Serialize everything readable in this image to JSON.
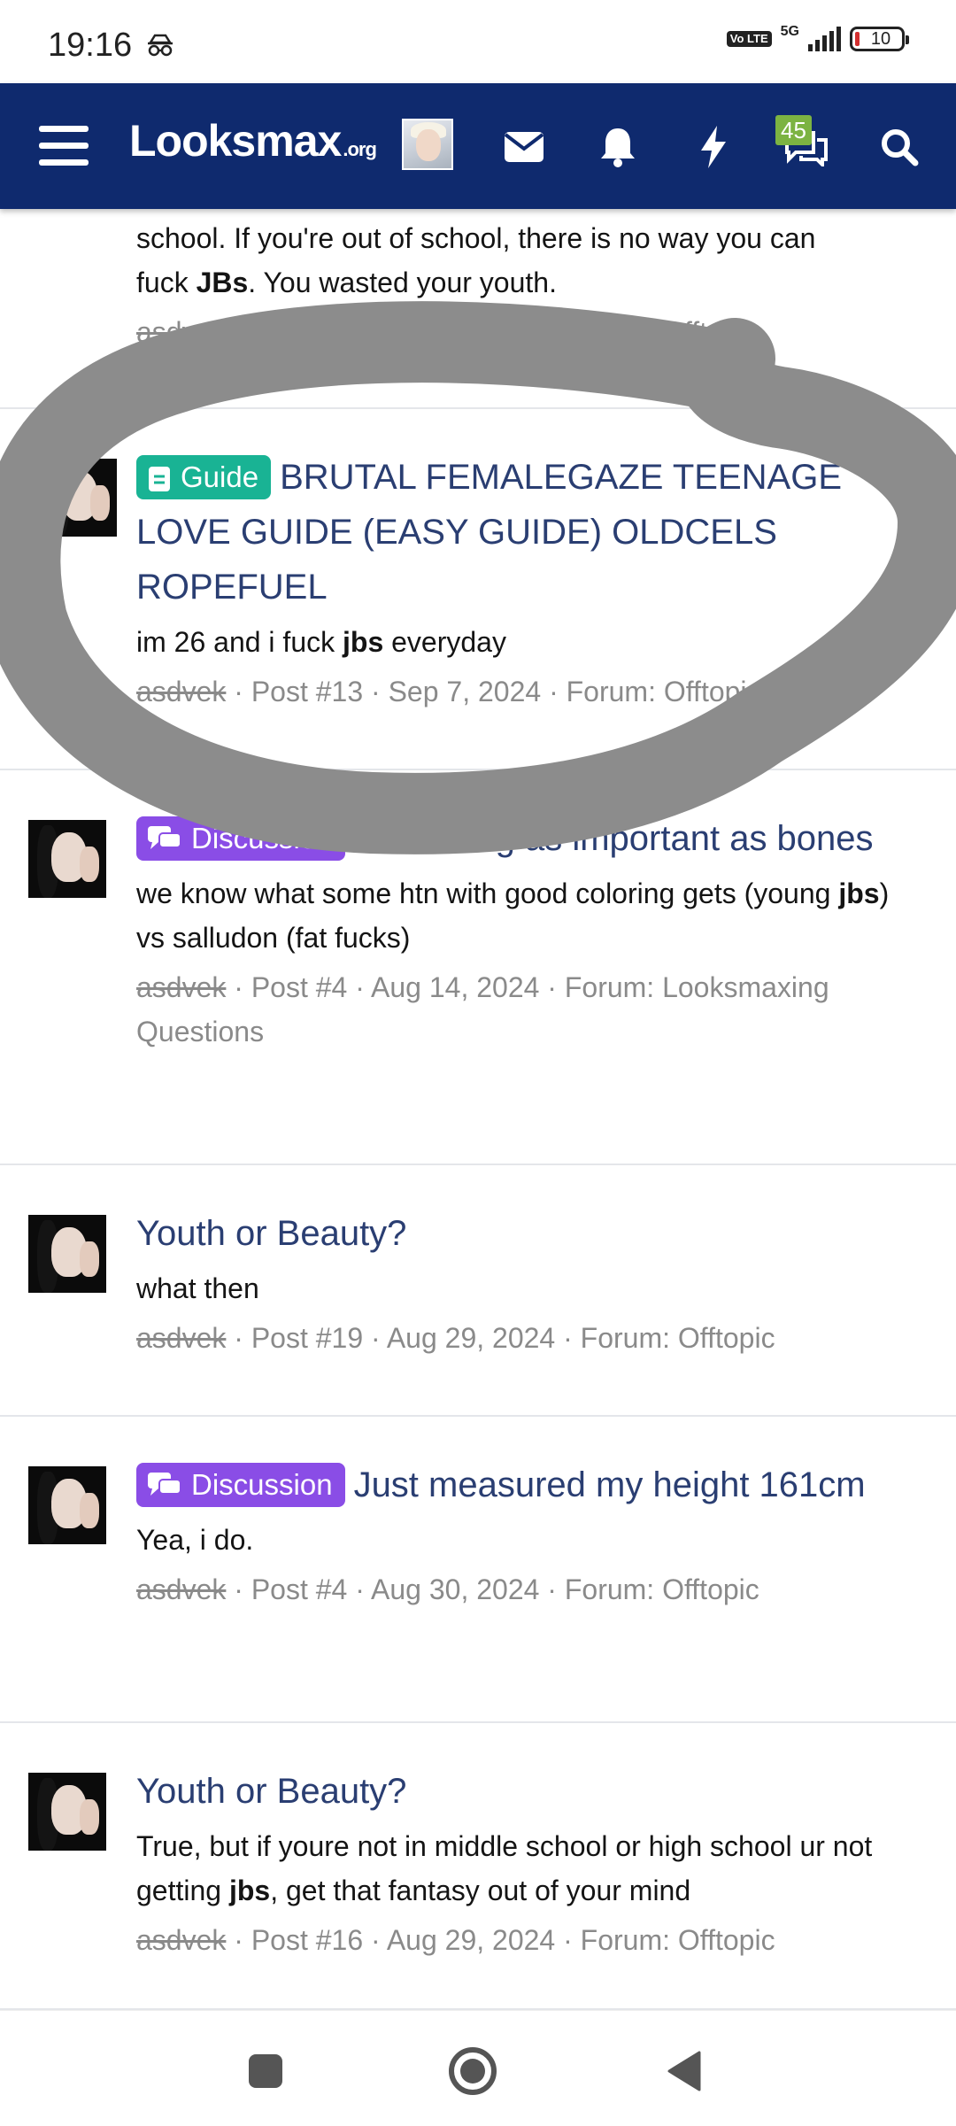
{
  "status_bar": {
    "time": "19:16",
    "network": "5G",
    "volte": "Vo LTE",
    "battery": "10"
  },
  "header": {
    "logo_main": "Looksmax",
    "logo_suffix": ".org",
    "notification_badge": "45",
    "icons": [
      "menu-icon",
      "avatar",
      "mail-icon",
      "bell-icon",
      "lightning-icon",
      "chat-icon",
      "search-icon"
    ],
    "brand_color": "#0f2a6e"
  },
  "results": [
    {
      "title_partial": "school. If you're out of school, there is no way you can",
      "snippet_line2_pre": "fuck ",
      "snippet_line2_bold": "JBs",
      "snippet_line2_post": ". You wasted your youth.",
      "author": "asdvek",
      "post": "Post #4",
      "date": "Aug 12, 2024",
      "forum": "Forum: Offtopic"
    },
    {
      "label": "Guide",
      "title": "BRUTAL FEMALEGAZE TEENAGE LOVE GUIDE (EASY GUIDE) OLDCELS ROPEFUEL",
      "snippet_pre": "im 26 and i fuck ",
      "snippet_bold": "jbs",
      "snippet_post": " everyday",
      "author": "asdvek",
      "post": "Post #13",
      "date": "Sep 7, 2024",
      "forum": "Forum: Offtopic"
    },
    {
      "label": "Discussion",
      "title": "Is coloring as important as bones",
      "snippet_pre": "we know what some htn with good coloring gets (young ",
      "snippet_bold": "jbs",
      "snippet_post": ") vs salludon (fat fucks)",
      "author": "asdvek",
      "post": "Post #4",
      "date": "Aug 14, 2024",
      "forum": "Forum: Looksmaxing Questions"
    },
    {
      "title": "Youth or Beauty?",
      "snippet": "what then",
      "author": "asdvek",
      "post": "Post #19",
      "date": "Aug 29, 2024",
      "forum": "Forum: Offtopic"
    },
    {
      "label": "Discussion",
      "title": "Just measured my height 161cm",
      "snippet": "Yea, i do.",
      "author": "asdvek",
      "post": "Post #4",
      "date": "Aug 30, 2024",
      "forum": "Forum: Offtopic"
    },
    {
      "title": "Youth or Beauty?",
      "snippet_pre": "True, but if youre not in middle school or high school ur not getting ",
      "snippet_bold": "jbs",
      "snippet_post": ", get that fantasy out of your mind",
      "author": "asdvek",
      "post": "Post #16",
      "date": "Aug 29, 2024",
      "forum": "Forum: Offtopic"
    }
  ],
  "meta_separator": " · ",
  "colors": {
    "guide_label": "#19b394",
    "discussion_label": "#8a4de6",
    "title_link": "#2a3e72",
    "scribble": "#8c8c8c"
  },
  "navbar": [
    "recents-button",
    "home-button",
    "back-button"
  ]
}
